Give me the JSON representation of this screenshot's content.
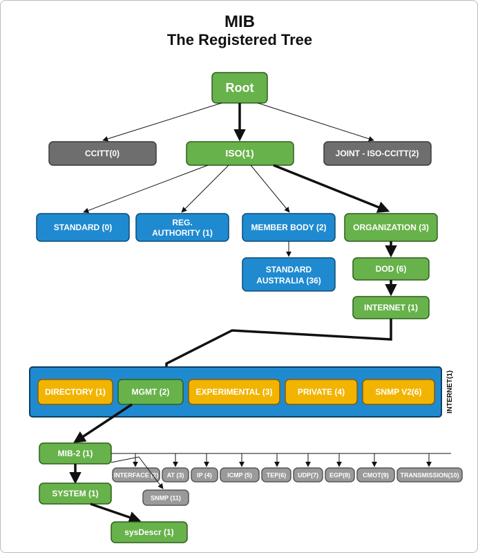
{
  "title_line1": "MIB",
  "title_line2": "The Registered Tree",
  "root": "Root",
  "level1": {
    "ccitt": "CCITT(0)",
    "iso": "ISO(1)",
    "joint": "JOINT - ISO-CCITT(2)"
  },
  "iso_children": {
    "standard": "STANDARD (0)",
    "reg_authority_l1": "REG.",
    "reg_authority_l2": "AUTHORITY (1)",
    "member_body": "MEMBER BODY (2)",
    "organization": "ORGANIZATION (3)"
  },
  "member_body_child_l1": "STANDARD",
  "member_body_child_l2": "AUSTRALIA (36)",
  "org_children": {
    "dod": "DOD (6)",
    "internet": "INTERNET (1)"
  },
  "internet_panel_label": "INTERNET(1)",
  "internet_children": {
    "directory": "DIRECTORY (1)",
    "mgmt": "MGMT (2)",
    "experimental": "EXPERIMENTAL (3)",
    "private": "PRIVATE (4)",
    "snmpv2": "SNMP V2(6)"
  },
  "mgmt_child": "MIB-2 (1)",
  "mib2_children": {
    "system": "SYSTEM (1)",
    "interface": "INTERFACE (2)",
    "at": "AT (3)",
    "ip": "IP (4)",
    "icmp": "ICMP (5)",
    "tep": "TEP(6)",
    "udp": "UDP(7)",
    "egp": "EGP(8)",
    "cmot": "CMOT(9)",
    "transmission": "TRANSMISSION(10)",
    "snmp": "SNMP (11)"
  },
  "system_child": "sysDescr (1)"
}
